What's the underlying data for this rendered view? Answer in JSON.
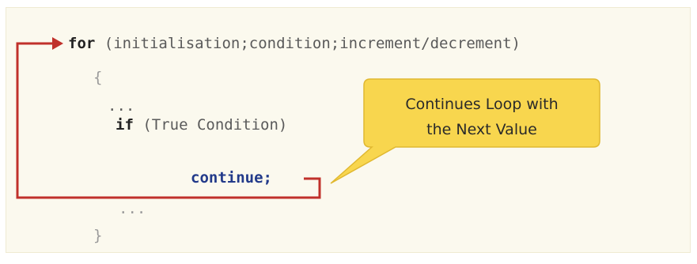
{
  "code": {
    "for_keyword": "for",
    "for_args": "(initialisation;condition;increment/decrement)",
    "open_brace": "{",
    "ellipsis_top": "...",
    "if_keyword": "if",
    "if_args": "(True Condition)",
    "continue_keyword": "continue",
    "continue_semicolon": ";",
    "ellipsis_bottom": "...",
    "close_brace": "}"
  },
  "callout": {
    "line1": "Continues Loop with",
    "line2": "the Next Value"
  },
  "colors": {
    "arrow": "#c0312b",
    "callout_fill": "#f8d64e",
    "callout_border": "#e0b830",
    "keyword_blue": "#223a8a"
  }
}
